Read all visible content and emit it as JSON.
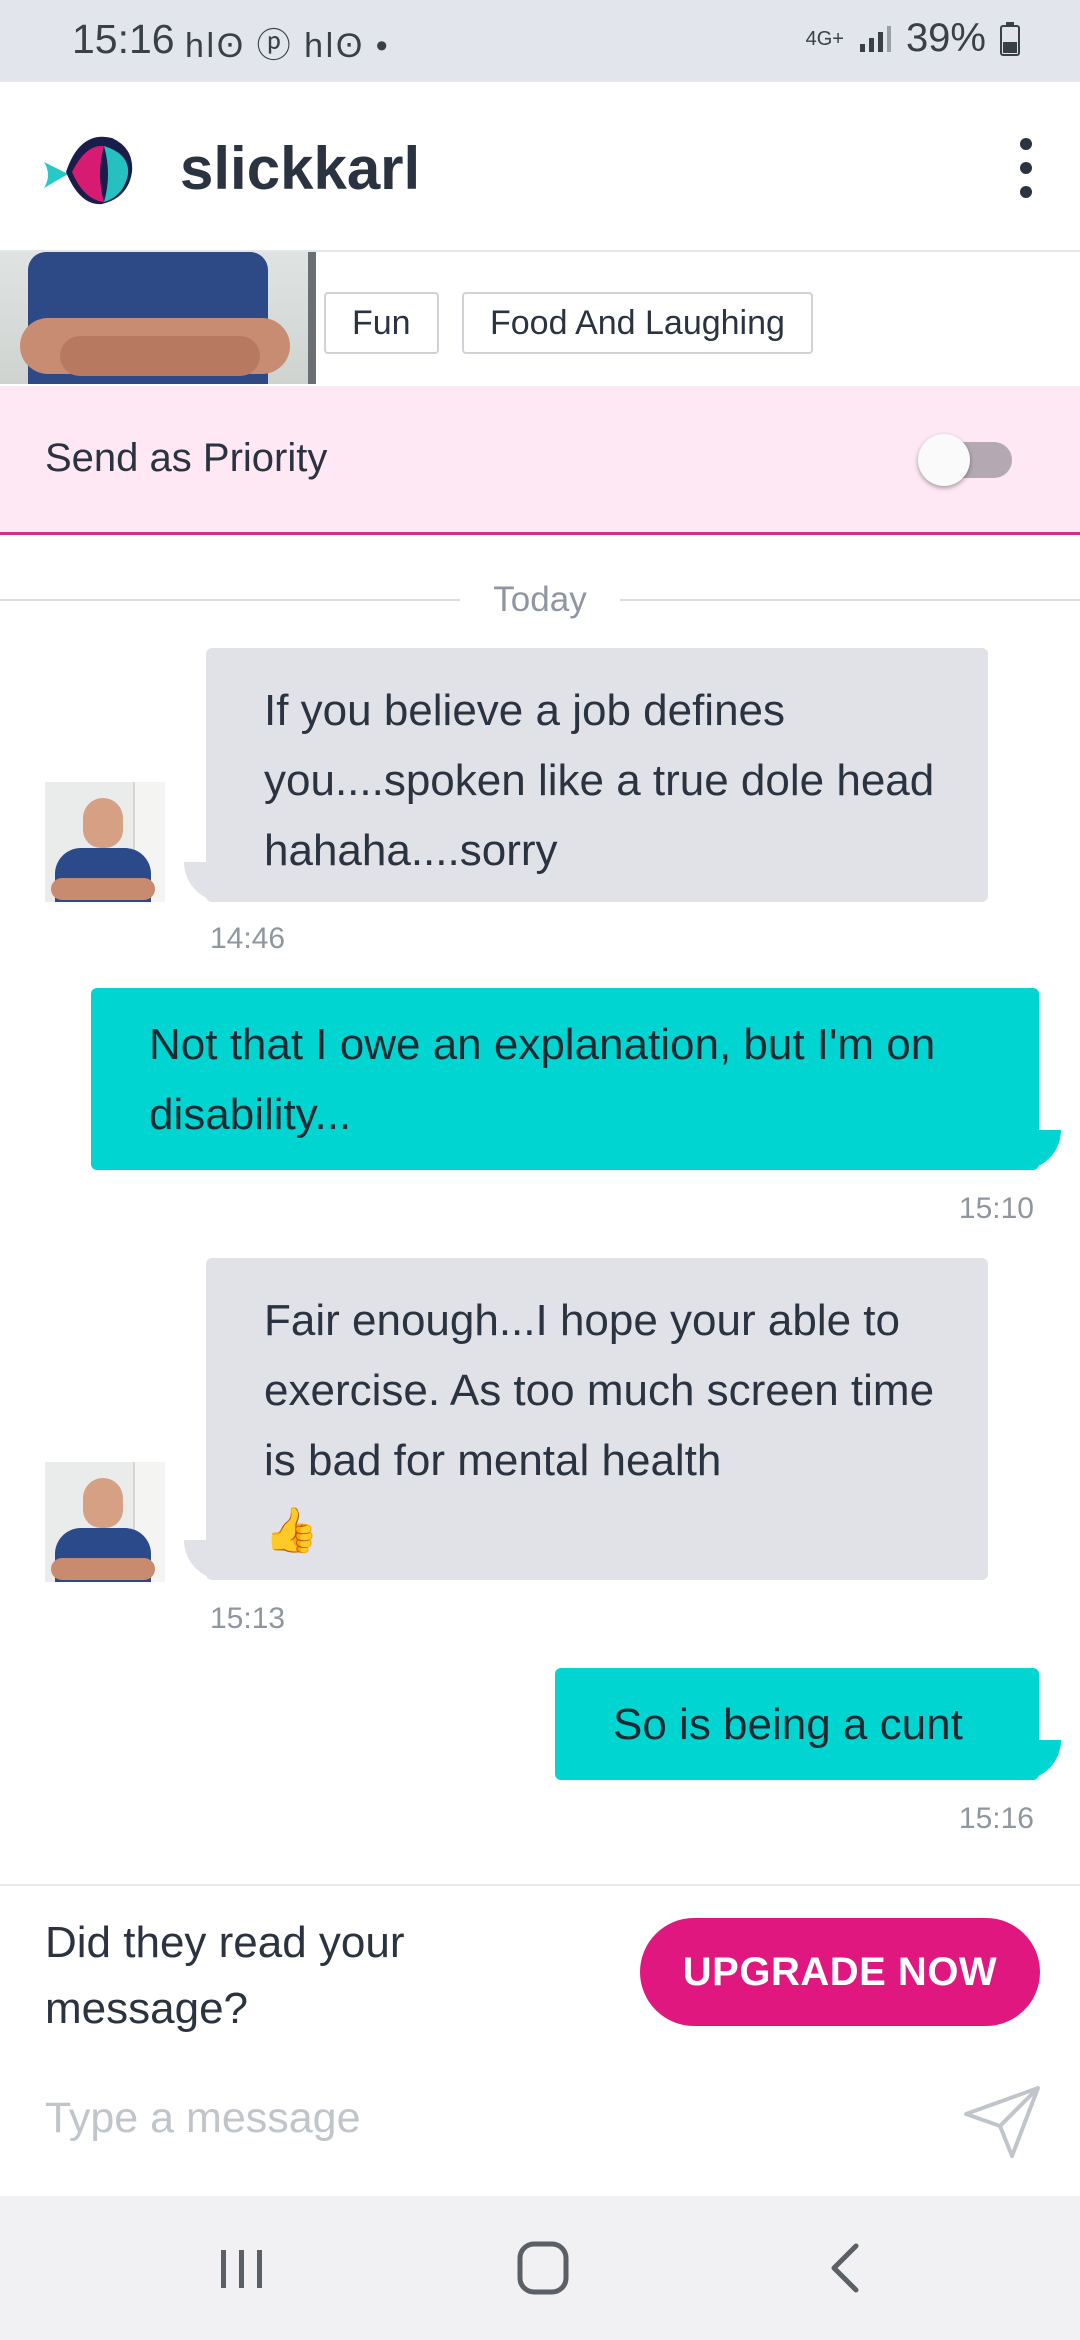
{
  "status_bar": {
    "time": "15:16",
    "notification_icons": "hǀʘ ⓟ hǀʘ •",
    "network": "4G+",
    "battery": "39%"
  },
  "app_bar": {
    "title": "slickkarl",
    "logo": "fish-logo-icon",
    "menu": "more-vert-icon"
  },
  "profile": {
    "tags": [
      "Fun",
      "Food And Laughing"
    ]
  },
  "priority": {
    "label": "Send as Priority",
    "enabled": false
  },
  "chat": {
    "date_divider": "Today",
    "messages": [
      {
        "direction": "in",
        "text": "If you believe a job defines you....spoken like a true dole head hahaha....sorry",
        "time": "14:46"
      },
      {
        "direction": "out",
        "text": "Not that I owe an explanation, but I'm on disability...",
        "time": "15:10"
      },
      {
        "direction": "in",
        "text": "Fair enough...I hope your able to exercise. As too much screen time is bad for mental health",
        "emoji": "👍",
        "time": "15:13"
      },
      {
        "direction": "out",
        "text": "So is being a cunt",
        "time": "15:16"
      }
    ]
  },
  "upgrade": {
    "question": "Did they read your message?",
    "button": "UPGRADE NOW"
  },
  "composer": {
    "placeholder": "Type a message",
    "send_icon": "send-icon"
  },
  "colors": {
    "accent_pink": "#e0177f",
    "outgoing_bubble": "#00d5d1",
    "incoming_bubble": "#e0e2e8",
    "priority_bg": "#fde8f3"
  }
}
